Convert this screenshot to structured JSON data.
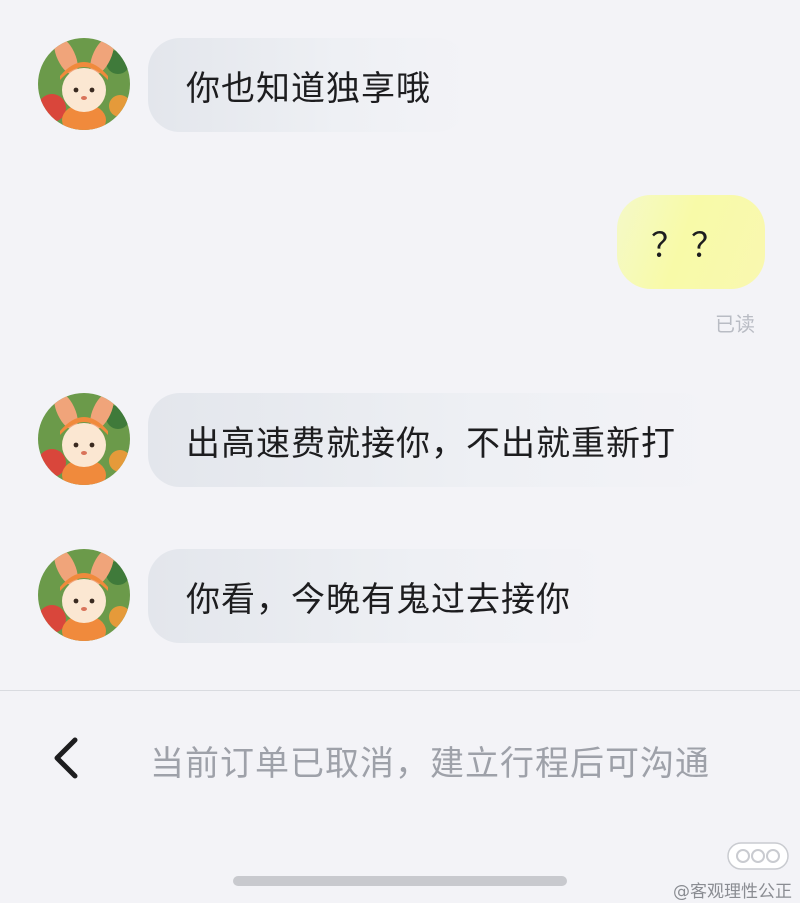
{
  "messages": [
    {
      "side": "incoming",
      "text": "你也知道独享哦"
    },
    {
      "side": "outgoing",
      "text": "？？",
      "status": "已读"
    },
    {
      "side": "incoming",
      "text": "出高速费就接你，不出就重新打"
    },
    {
      "side": "incoming",
      "text": "你看，今晚有鬼过去接你"
    }
  ],
  "bottom_bar": {
    "back_icon": "chevron-left-icon",
    "hint": "当前订单已取消，建立行程后可沟通"
  },
  "watermark": {
    "text": "@客观理性公正"
  },
  "colors": {
    "background": "#f3f3f7",
    "incoming_bubble": "#e6e8ee",
    "outgoing_bubble": "#f8faa8",
    "hint_text": "#9ea1a9"
  }
}
